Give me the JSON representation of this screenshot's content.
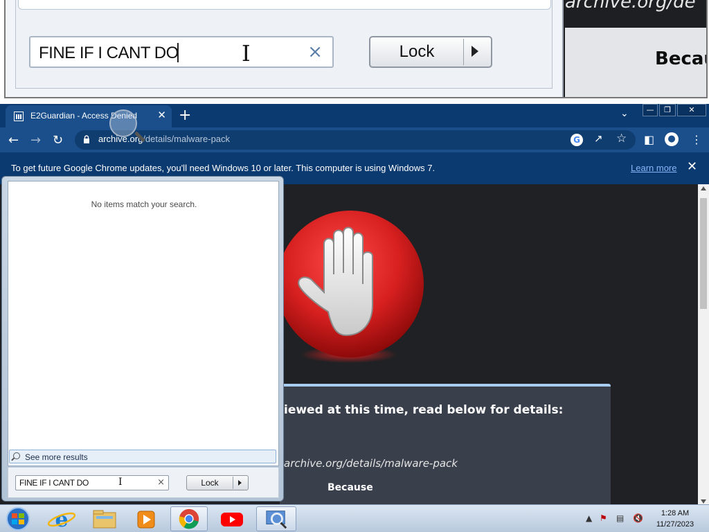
{
  "zoom": {
    "search_text": "FINE IF I CANT DO",
    "clear_glyph": "×",
    "lock_label": "Lock",
    "url_fragment": "archive.org/de",
    "because_fragment": "Becau"
  },
  "browser": {
    "tab_title": "E2Guardian - Access Denied",
    "tab_close": "✕",
    "new_tab": "+",
    "tab_menu": "⌄",
    "window_buttons": [
      "—",
      "❐",
      "✕"
    ],
    "url_host": "archive.org",
    "url_path": "/details/malware-pack",
    "google_icon_letter": "G",
    "infobar_text": "To get future Google Chrome updates, you'll need Windows 10 or later. This computer is using Windows 7.",
    "learn_more": "Learn more",
    "infobar_close": "✕"
  },
  "page": {
    "heading": "iewed at this time, read below for details:",
    "blocked_url": "archive.org/details/malware-pack",
    "because": "Because"
  },
  "startmenu": {
    "no_items": "No items match your search.",
    "see_more": "See more results",
    "search_value": "FINE IF I CANT DO",
    "clear_glyph": "×",
    "lock_label": "Lock"
  },
  "taskbar": {
    "time": "1:28 AM",
    "date": "11/27/2023",
    "pinned": [
      "start-orb",
      "internet-explorer",
      "file-explorer",
      "media-player",
      "chrome",
      "youtube",
      "search-app"
    ],
    "active": "search-app"
  },
  "colors": {
    "titlebar": "#0b3a70",
    "toolbar": "#1a4f8c",
    "page_bg": "#202124",
    "stop_red": "#d61f1f",
    "panel_accent": "#a9cdf1"
  }
}
